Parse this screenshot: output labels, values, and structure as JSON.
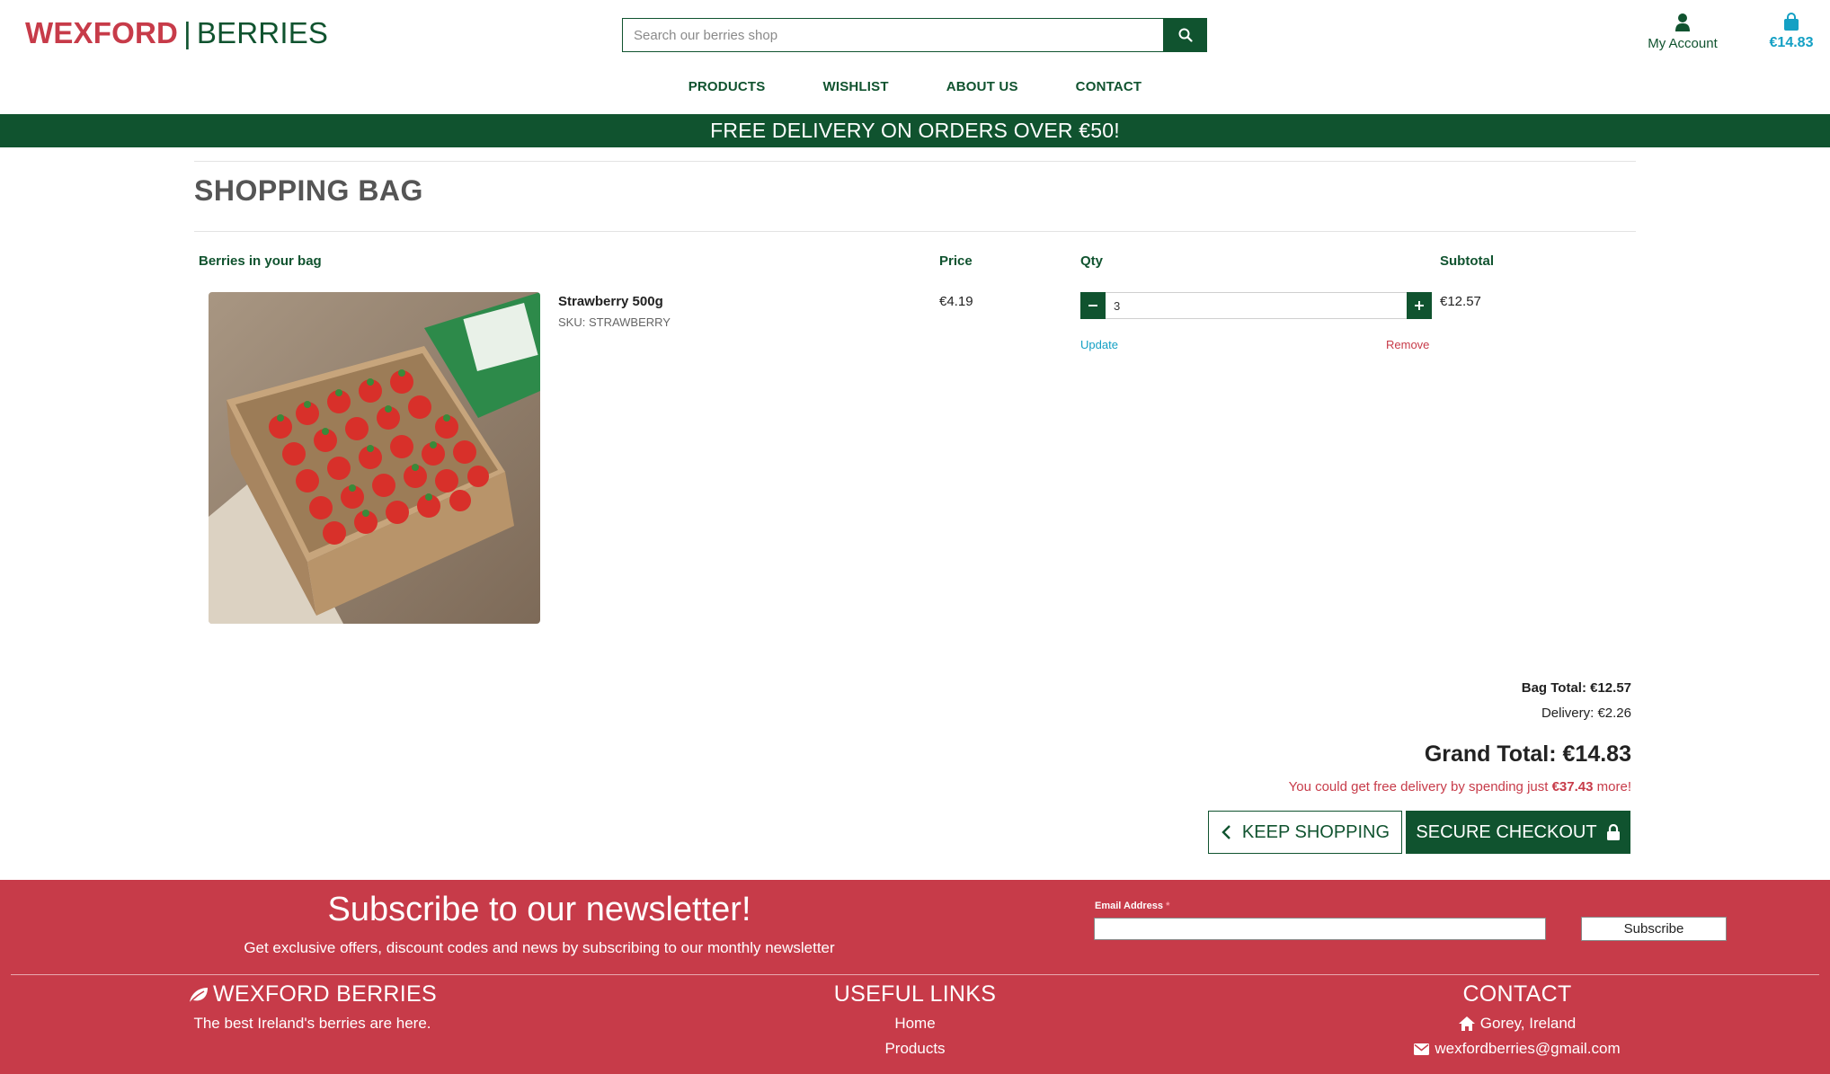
{
  "header": {
    "brand_primary": "WEXFORD",
    "brand_separator": "|",
    "brand_secondary": "BERRIES",
    "search_placeholder": "Search our berries shop",
    "account_label": "My Account",
    "bag_total": "€14.83",
    "icons": [
      "search-icon",
      "user-icon",
      "shopping-bag-icon"
    ]
  },
  "nav": {
    "items": [
      "PRODUCTS",
      "WISHLIST",
      "ABOUT US",
      "CONTACT"
    ]
  },
  "banner": {
    "text": "FREE DELIVERY ON ORDERS OVER €50!"
  },
  "bag": {
    "title": "SHOPPING BAG",
    "columns": {
      "item": "Berries in your bag",
      "price": "Price",
      "qty": "Qty",
      "subtotal": "Subtotal"
    },
    "items": [
      {
        "name": "Strawberry 500g",
        "sku": "SKU: STRAWBERRY",
        "price": "€4.19",
        "qty": "3",
        "update_label": "Update",
        "remove_label": "Remove",
        "subtotal": "€12.57"
      }
    ],
    "totals": {
      "bag_total": "Bag Total: €12.57",
      "delivery": "Delivery: €2.26",
      "grand_total": "Grand Total: €14.83",
      "free_delivery_prefix": "You could get free delivery by spending just",
      "free_delivery_amount": "€37.43",
      "free_delivery_suffix": "more!"
    },
    "keep_shopping_label": "KEEP SHOPPING",
    "checkout_label": "SECURE CHECKOUT"
  },
  "footer": {
    "newsletter_title": "Subscribe to our newsletter!",
    "newsletter_subtitle": "Get exclusive offers, discount codes and news by subscribing to our monthly newsletter",
    "email_label": "Email Address",
    "email_required_mark": "*",
    "subscribe_label": "Subscribe",
    "brand_col": {
      "title": "WEXFORD BERRIES",
      "tagline": "The best Ireland's berries are here."
    },
    "links_col": {
      "title": "USEFUL LINKS",
      "links": [
        "Home",
        "Products"
      ]
    },
    "contact_col": {
      "title": "CONTACT",
      "location": "Gorey, Ireland",
      "email": "wexfordberries@gmail.com"
    }
  },
  "colors": {
    "brand_red": "#c73b49",
    "brand_green": "#10532f",
    "link_blue": "#14a0c4"
  }
}
